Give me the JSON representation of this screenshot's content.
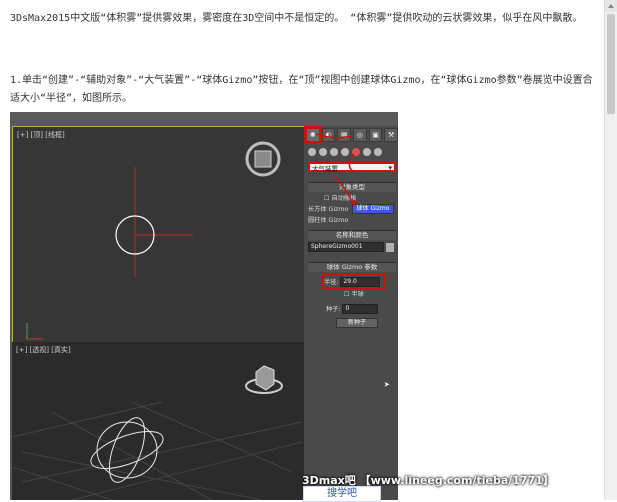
{
  "article": {
    "paragraph1": "3DsMax2015中文版“体积雾”提供雾效果，雾密度在3D空间中不是恒定的。 “体积雾”提供吹动的云状雾效果，似乎在风中飘散。",
    "paragraph2": "1.单击“创建”-“辅助对象”-“大气装置”-“球体Gizmo”按钮，在“顶”视图中创建球体Gizmo，在“球体Gizmo参数”卷展览中设置合适大小“半径”，如图所示。"
  },
  "viewports": {
    "top_label": "[+] [顶] [线框]",
    "persp_label": "[+] [透视] [真实]"
  },
  "command_panel": {
    "tabs": [
      "✺",
      "◐",
      "▦",
      "◎",
      "▣",
      "⚒"
    ],
    "dropdown_value": "大气装置",
    "object_type": {
      "title": "对象类型",
      "autogrid": "自动栅格",
      "box_gizmo": "长方体 Gizmo",
      "sphere_gizmo": "球体 Gizmo",
      "cylinder_gizmo": "圆柱体 Gizmo"
    },
    "name_color": {
      "title": "名称和颜色",
      "name_value": "SphereGizmo001"
    },
    "sphere_params": {
      "title": "球体 Gizmo 参数",
      "radius_label": "半径:",
      "radius_value": "29.0",
      "hemisphere": "半球",
      "seed_label": "种子:",
      "seed_value": "0",
      "new_seed": "新种子"
    }
  },
  "watermark": {
    "text": "3Dmax吧 【www.lineeg.com/tieba/1771】",
    "logo": "搜学吧"
  },
  "colors": {
    "highlight_red": "#cc1111",
    "viewport_border": "#c8a84a",
    "gizmo_blue": "#3c5ad8"
  }
}
